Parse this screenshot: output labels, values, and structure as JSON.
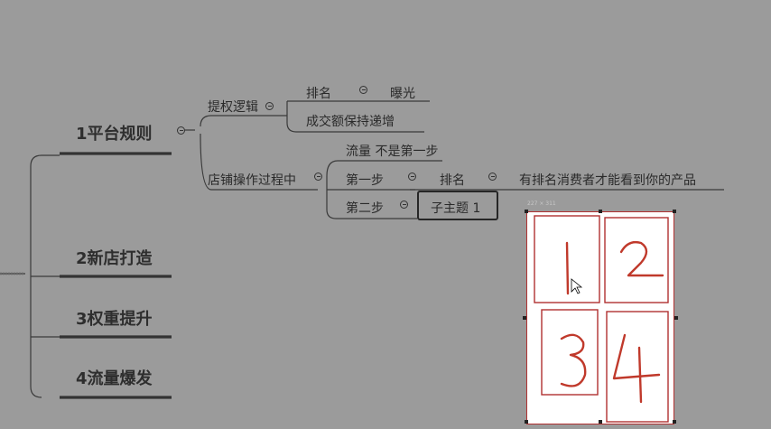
{
  "mindmap": {
    "main_topics": [
      {
        "label": "1平台规则"
      },
      {
        "label": "2新店打造"
      },
      {
        "label": "3权重提升"
      },
      {
        "label": "4流量爆发"
      }
    ],
    "branch_a": {
      "label": "提权逻辑",
      "children": [
        {
          "label": "排名",
          "child": "曝光"
        },
        {
          "label": "成交额保持递增"
        }
      ]
    },
    "branch_b": {
      "label": "店铺操作过程中",
      "children": [
        {
          "label": "流量 不是第一步"
        },
        {
          "label": "第一步",
          "child": "排名",
          "grandchild": "有排名消费者才能看到你的产品"
        },
        {
          "label": "第二步",
          "child": "子主题 1"
        }
      ]
    }
  },
  "image_panel": {
    "size_text": "227 × 311",
    "quadrants": [
      "1",
      "2",
      "3",
      "4"
    ],
    "stroke_color": "#b03030"
  }
}
